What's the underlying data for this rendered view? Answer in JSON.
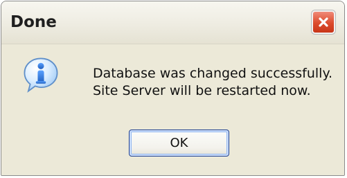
{
  "dialog": {
    "title": "Done",
    "message_lines": [
      "Database was changed successfully.",
      "Site Server will be restarted now."
    ],
    "ok_label": "OK",
    "icon": "info-icon",
    "close_icon": "close-icon"
  },
  "colors": {
    "titlebar_bg": "#efede3",
    "dialog_bg": "#ece9d8",
    "close_button": "#d94c2f",
    "info_icon": "#2f79d6",
    "ok_focus": "#1e3f8f"
  }
}
